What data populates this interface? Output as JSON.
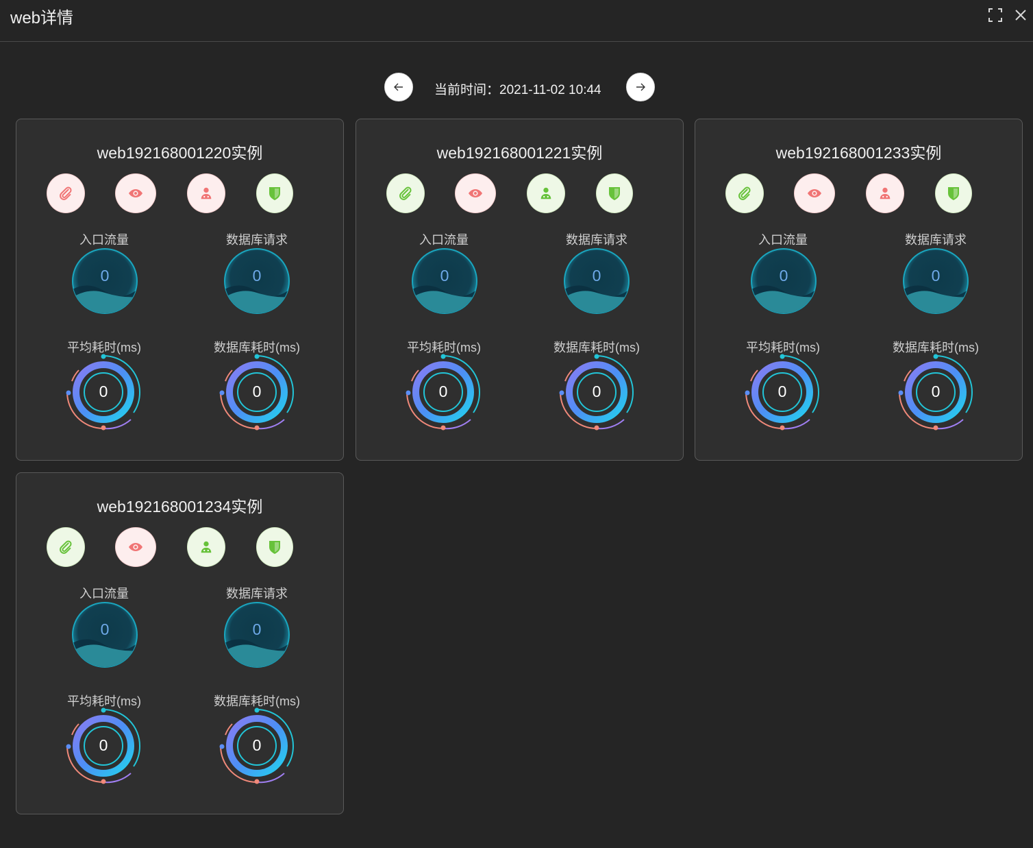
{
  "window": {
    "title": "web详情",
    "fullscreen_icon": "fullscreen-icon",
    "close_icon": "close-icon"
  },
  "time_nav": {
    "prev_icon": "arrow-left-icon",
    "next_icon": "arrow-right-icon",
    "current_time": "当前时间：2021-11-02 10:44"
  },
  "labels": {
    "ingress": "入口流量",
    "db_requests": "数据库请求",
    "avg_latency": "平均耗时(ms)",
    "db_latency": "数据库耗时(ms)"
  },
  "status_icons": [
    "paperclip-icon",
    "eye-icon",
    "user-doctor-icon",
    "shield-icon"
  ],
  "colors": {
    "status_red": "#f07575",
    "status_green": "#67c23a"
  },
  "instances": [
    {
      "title": "web192168001220实例",
      "status": [
        "red",
        "red",
        "red",
        "green"
      ],
      "ingress": "0",
      "db_requests": "0",
      "avg_latency": "0",
      "db_latency": "0"
    },
    {
      "title": "web192168001221实例",
      "status": [
        "green",
        "red",
        "green",
        "green"
      ],
      "ingress": "0",
      "db_requests": "0",
      "avg_latency": "0",
      "db_latency": "0"
    },
    {
      "title": "web192168001233实例",
      "status": [
        "green",
        "red",
        "red",
        "green"
      ],
      "ingress": "0",
      "db_requests": "0",
      "avg_latency": "0",
      "db_latency": "0"
    },
    {
      "title": "web192168001234实例",
      "status": [
        "green",
        "red",
        "green",
        "green"
      ],
      "ingress": "0",
      "db_requests": "0",
      "avg_latency": "0",
      "db_latency": "0"
    }
  ]
}
